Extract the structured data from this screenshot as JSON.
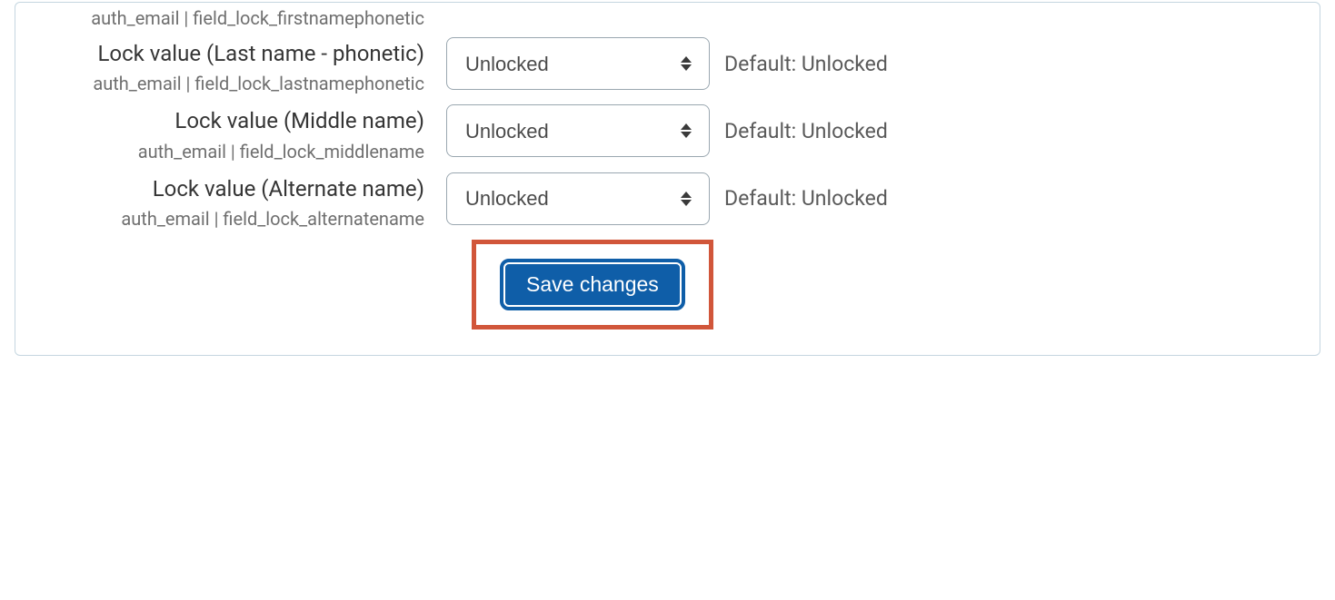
{
  "orphan_meta": "auth_email | field_lock_firstnamephonetic",
  "fields": [
    {
      "label": "Lock value (Last name - phonetic)",
      "meta": "auth_email | field_lock_lastnamephonetic",
      "value": "Unlocked",
      "default": "Default: Unlocked"
    },
    {
      "label": "Lock value (Middle name)",
      "meta": "auth_email | field_lock_middlename",
      "value": "Unlocked",
      "default": "Default: Unlocked"
    },
    {
      "label": "Lock value (Alternate name)",
      "meta": "auth_email | field_lock_alternatename",
      "value": "Unlocked",
      "default": "Default: Unlocked"
    }
  ],
  "save_label": "Save changes"
}
